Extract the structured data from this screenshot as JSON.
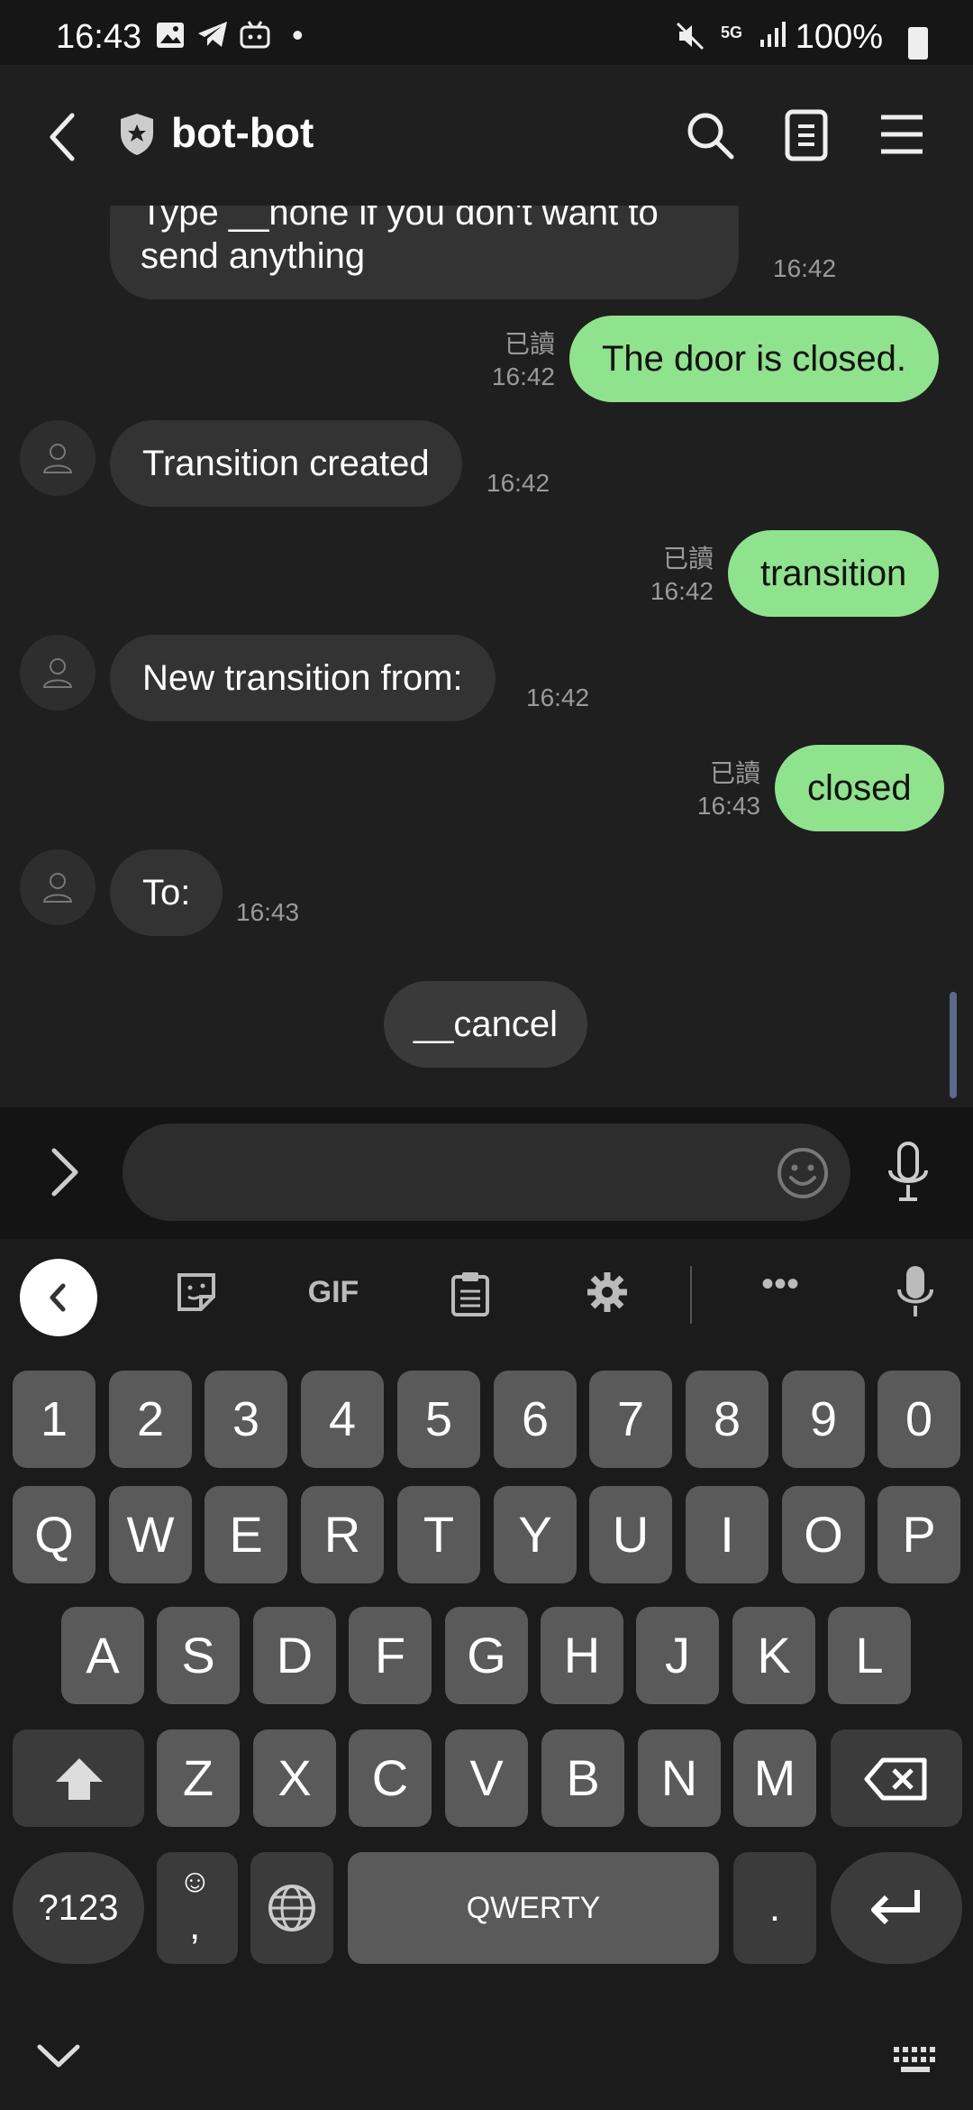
{
  "status_bar": {
    "time": "16:43",
    "battery": "100%",
    "network": "5G",
    "dot": "•"
  },
  "header": {
    "title": "bot-bot"
  },
  "messages": [
    {
      "direction": "in",
      "text": "Type __none if you don't want to send anything",
      "time": "16:42"
    },
    {
      "direction": "out",
      "text": "The door is closed.",
      "read": "已讀",
      "time": "16:42"
    },
    {
      "direction": "in",
      "text": "Transition created",
      "time": "16:42"
    },
    {
      "direction": "out",
      "text": "transition",
      "read": "已讀",
      "time": "16:42"
    },
    {
      "direction": "in",
      "text": "New transition from:",
      "time": "16:42"
    },
    {
      "direction": "out",
      "text": "closed",
      "read": "已讀",
      "time": "16:43"
    },
    {
      "direction": "in",
      "text": "To:",
      "time": "16:43"
    }
  ],
  "quick_reply": "__cancel",
  "input": {
    "value": "",
    "placeholder": ""
  },
  "keyboard": {
    "toolbar": {
      "gif": "GIF",
      "more": "•••"
    },
    "number_row": [
      "1",
      "2",
      "3",
      "4",
      "5",
      "6",
      "7",
      "8",
      "9",
      "0"
    ],
    "row1": [
      "Q",
      "W",
      "E",
      "R",
      "T",
      "Y",
      "U",
      "I",
      "O",
      "P"
    ],
    "row2": [
      "A",
      "S",
      "D",
      "F",
      "G",
      "H",
      "J",
      "K",
      "L"
    ],
    "row3": [
      "Z",
      "X",
      "C",
      "V",
      "B",
      "N",
      "M"
    ],
    "symbols_key": "?123",
    "comma_key": ",",
    "space_key": "QWERTY",
    "period_key": "."
  },
  "colors": {
    "outgoing_bubble": "#8ee38c",
    "incoming_bubble": "#333333",
    "background": "#1f1f1f"
  }
}
